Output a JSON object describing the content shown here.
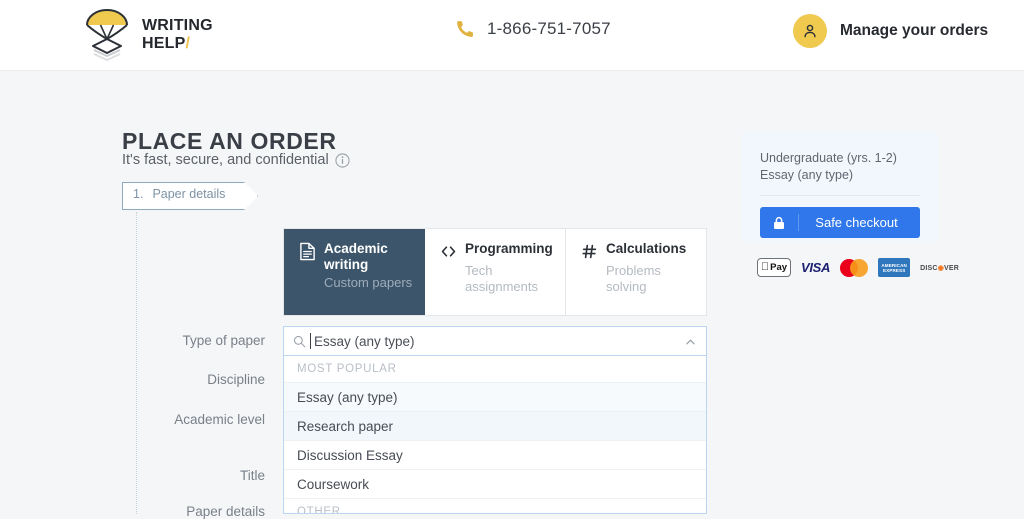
{
  "header": {
    "logo": {
      "line1": "WRITING",
      "line2": "HELP",
      "slash": "/",
      "icon": "parachute-papers-logo"
    },
    "phone": {
      "icon": "phone-icon",
      "number": "1-866-751-7057"
    },
    "account": {
      "icon": "user-avatar-icon",
      "label": "Manage your orders"
    }
  },
  "main": {
    "title": "PLACE AN ORDER",
    "subtitle": "It's fast, secure, and confidential",
    "subtitle_icon": "info-circle-icon",
    "step": {
      "number": "1.",
      "label": "Paper details"
    },
    "tabs": [
      {
        "icon": "document-icon",
        "title": "Academic writing",
        "desc": "Custom papers",
        "active": true
      },
      {
        "icon": "code-brackets-icon",
        "title": "Programming",
        "desc": "Tech assignments",
        "active": false
      },
      {
        "icon": "hash-icon",
        "title": "Calculations",
        "desc": "Problems solving",
        "active": false
      }
    ],
    "labels": {
      "type_of_paper": "Type of paper",
      "discipline": "Discipline",
      "academic_level": "Academic level",
      "title": "Title",
      "paper_details": "Paper details"
    },
    "type_select": {
      "icon": "search-icon",
      "value": "Essay (any type)",
      "placeholder": "Essay (any type)",
      "chevron": "chevron-up-icon",
      "groups": [
        {
          "label": "MOST POPULAR",
          "items": [
            "Essay (any type)",
            "Research paper",
            "Discussion Essay",
            "Coursework"
          ]
        },
        {
          "label": "OTHER",
          "items": []
        }
      ]
    }
  },
  "sidebar": {
    "summary": {
      "level": "Undergraduate (yrs. 1-2)",
      "paper_type": "Essay (any type)"
    },
    "checkout": {
      "icon": "lock-icon",
      "label": "Safe checkout",
      "color": "#2f77ea"
    },
    "payments": [
      {
        "name": "apple-pay",
        "apple": "",
        "text": "Pay"
      },
      {
        "name": "visa",
        "text": "VISA"
      },
      {
        "name": "mastercard",
        "text": ""
      },
      {
        "name": "amex",
        "line1": "AMERICAN",
        "line2": "EXPRESS"
      },
      {
        "name": "discover",
        "pre": "DISC",
        "o": "◉",
        "post": "VER"
      }
    ]
  },
  "colors": {
    "accent": "#ecc24a",
    "active_tab": "#3d556b",
    "checkout_blue": "#2f77ea",
    "page_bg": "#f5f6f7"
  }
}
